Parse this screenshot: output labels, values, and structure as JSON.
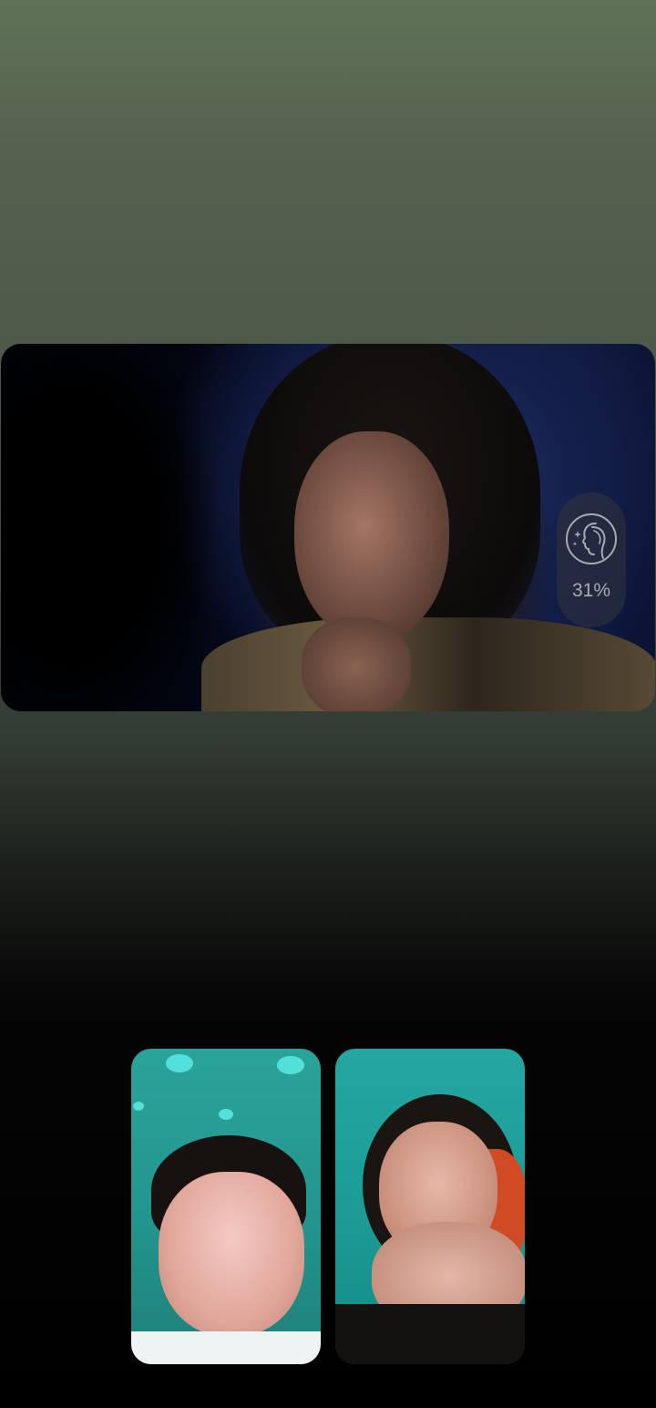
{
  "call": {
    "main_feed": {
      "beauty_filter": {
        "icon": "face-beauty-icon",
        "level_text": "31%"
      }
    },
    "participants": [
      {
        "position": "left"
      },
      {
        "position": "right"
      }
    ]
  },
  "colors": {
    "pill_background": "#32343c",
    "pill_text": "#a9abb2",
    "tile_teal": "#22958e"
  }
}
